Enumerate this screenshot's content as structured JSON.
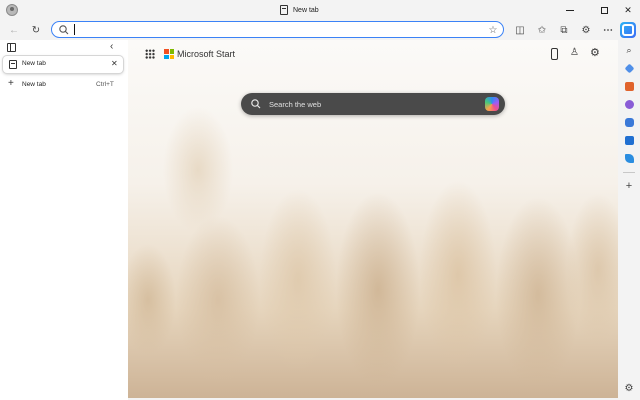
{
  "window": {
    "tab_title": "New tab",
    "controls": {
      "minimize": "minimize-icon",
      "maximize": "maximize-icon",
      "close": "close-icon"
    }
  },
  "toolbar": {
    "address_value": "",
    "icons": [
      "back-icon",
      "refresh-icon",
      "search-icon",
      "favorite-star-icon",
      "split-screen-icon",
      "favorites-icon",
      "collections-icon",
      "extensions-icon",
      "more-icon",
      "copilot-icon"
    ]
  },
  "vertical_tabs": {
    "tabs": [
      {
        "label": "New tab",
        "active": true
      }
    ],
    "new_tab_label": "New tab",
    "new_tab_shortcut": "Ctrl+T"
  },
  "new_tab_page": {
    "brand": "Microsoft Start",
    "search_placeholder": "Search the web"
  },
  "right_sidebar": {
    "items": [
      "search-icon",
      "shopping-icon",
      "tools-icon",
      "games-icon",
      "microsoft365-icon",
      "outlook-icon",
      "drop-icon",
      "add-icon",
      "settings-icon"
    ]
  },
  "colors": {
    "address_focus": "#3b82f6",
    "search_box_bg": "#4a4a4a",
    "ms_red": "#f25022",
    "ms_green": "#7fba00",
    "ms_blue": "#00a4ef",
    "ms_yellow": "#ffb900"
  }
}
